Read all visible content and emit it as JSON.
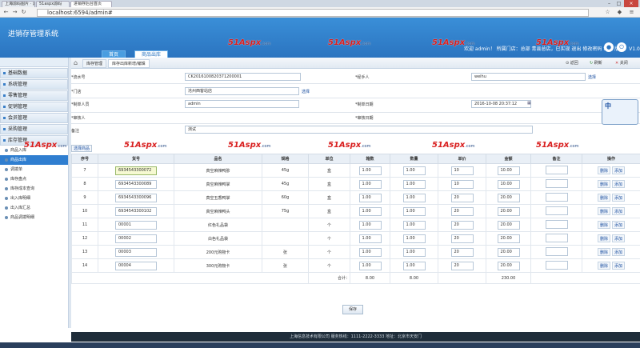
{
  "browser": {
    "tabs": [
      "上海源码图片 · 源码网站",
      "51aspx源码",
      "进销存后台首页"
    ],
    "url": "localhost:6594/admin#"
  },
  "app": {
    "title": "进销存管理系统",
    "main_tabs": [
      "首页",
      "商品出库"
    ],
    "user_info": "欢迎 admin！ 所属门店：总部 青县总店，已实现  退出  修改密码  帮助  版本：V1.0",
    "header_icons": [
      "user-icon",
      "exit-icon"
    ]
  },
  "sidebar": {
    "groups": [
      "基础数据",
      "系统管理",
      "零售管理",
      "促销管理",
      "会员管理",
      "采购管理",
      "库存管理"
    ],
    "items": [
      "商品入库",
      "商品出库",
      "调拨单",
      "库存盘点",
      "库存成本查询",
      "出入库明细",
      "出入库汇总",
      "商品调拨明细"
    ],
    "active_item": "商品出库"
  },
  "breadcrumb": {
    "tabs": [
      "库存管理",
      "库存出库新增/编辑"
    ],
    "refresh": "刷新",
    "back": "返回",
    "close": "关闭"
  },
  "form": {
    "order_no_label": "*流水号",
    "order_no": "CK2016100820371200001",
    "handler_label": "*经手人",
    "handler": "weihu",
    "select": "选择",
    "store_label": "*门店",
    "store": "沧州西客站店",
    "creator_label": "*制单人员",
    "creator": "admin",
    "create_date_label": "*制单日期",
    "create_date": "2016-10-08 20:37:12",
    "auditor_label": "*审核人",
    "audit_date_label": "*审核日期",
    "remark_label": "备注",
    "remark": "测试"
  },
  "select_goods": "选择商品",
  "table": {
    "headers": [
      "序号",
      "货号",
      "品名",
      "规格",
      "单位",
      "箱数",
      "数量",
      "单价",
      "金额",
      "备注",
      "操作"
    ],
    "rows": [
      {
        "no": "7",
        "code": "6934543300072",
        "name": "真空麻辣鸭胗",
        "spec": "45g",
        "unit": "盒",
        "boxes": "1.00",
        "qty": "1.00",
        "price": "10",
        "amount": "10.00",
        "remark": ""
      },
      {
        "no": "8",
        "code": "6934543300089",
        "name": "真空麻辣鸭掌",
        "spec": "45g",
        "unit": "盒",
        "boxes": "1.00",
        "qty": "1.00",
        "price": "10",
        "amount": "10.00",
        "remark": ""
      },
      {
        "no": "9",
        "code": "6934543300096",
        "name": "真空五香鸭掌",
        "spec": "60g",
        "unit": "盒",
        "boxes": "1.00",
        "qty": "1.00",
        "price": "20",
        "amount": "20.00",
        "remark": ""
      },
      {
        "no": "10",
        "code": "6934543300102",
        "name": "真空麻辣鸭头",
        "spec": "75g",
        "unit": "盒",
        "boxes": "1.00",
        "qty": "1.00",
        "price": "20",
        "amount": "20.00",
        "remark": ""
      },
      {
        "no": "11",
        "code": "00001",
        "name": "红色礼品袋",
        "spec": "",
        "unit": "个",
        "boxes": "1.00",
        "qty": "1.00",
        "price": "20",
        "amount": "20.00",
        "remark": ""
      },
      {
        "no": "12",
        "code": "00002",
        "name": "白色礼品袋",
        "spec": "",
        "unit": "个",
        "boxes": "1.00",
        "qty": "1.00",
        "price": "20",
        "amount": "20.00",
        "remark": ""
      },
      {
        "no": "13",
        "code": "00003",
        "name": "200元购物卡",
        "spec": "张",
        "unit": "个",
        "boxes": "1.00",
        "qty": "1.00",
        "price": "20",
        "amount": "20.00",
        "remark": ""
      },
      {
        "no": "14",
        "code": "00004",
        "name": "300元购物卡",
        "spec": "张",
        "unit": "个",
        "boxes": "1.00",
        "qty": "1.00",
        "price": "20",
        "amount": "20.00",
        "remark": ""
      }
    ],
    "delete": "删除",
    "add": "添加",
    "total_label": "合计：",
    "total_boxes": "8.00",
    "total_qty": "8.00",
    "total_amount": "230.00"
  },
  "save": "保存",
  "footer": "上海信息技术有限公司  服务热线：1111-2222-3333  地址：北京市天安门",
  "watermark": "51Aspx",
  "watermark_suffix": ".com",
  "ime": "中"
}
